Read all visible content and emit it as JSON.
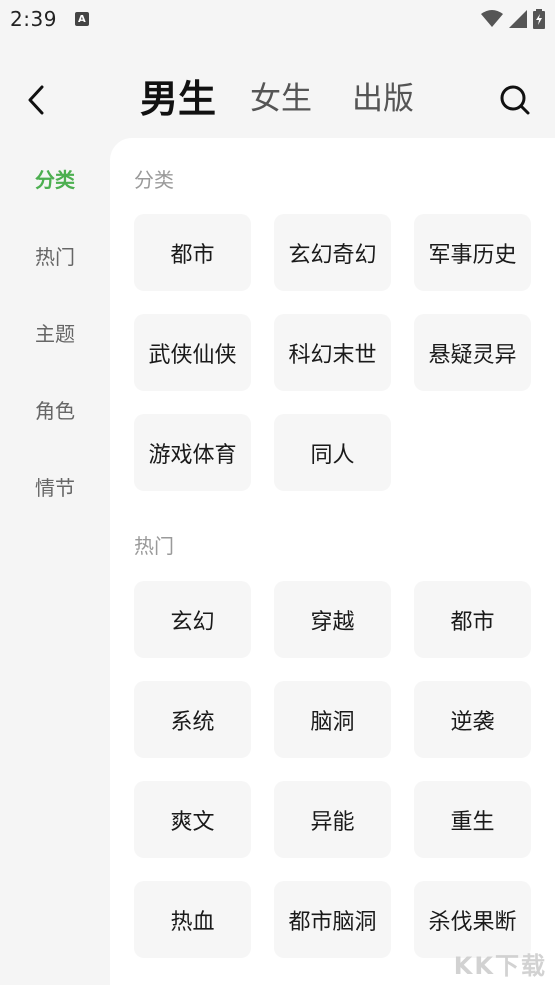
{
  "status_bar": {
    "time": "2:39",
    "app_icon_letter": "A"
  },
  "header": {
    "tabs": [
      {
        "label": "男生",
        "active": true
      },
      {
        "label": "女生",
        "active": false
      },
      {
        "label": "出版",
        "active": false
      }
    ]
  },
  "side_nav": {
    "items": [
      {
        "label": "分类",
        "active": true
      },
      {
        "label": "热门",
        "active": false
      },
      {
        "label": "主题",
        "active": false
      },
      {
        "label": "角色",
        "active": false
      },
      {
        "label": "情节",
        "active": false
      }
    ]
  },
  "sections": [
    {
      "title": "分类",
      "tags": [
        "都市",
        "玄幻奇幻",
        "军事历史",
        "武侠仙侠",
        "科幻末世",
        "悬疑灵异",
        "游戏体育",
        "同人"
      ]
    },
    {
      "title": "热门",
      "tags": [
        "玄幻",
        "穿越",
        "都市",
        "系统",
        "脑洞",
        "逆袭",
        "爽文",
        "异能",
        "重生",
        "热血",
        "都市脑洞",
        "杀伐果断"
      ]
    }
  ],
  "watermark": "KK下载",
  "colors": {
    "accent": "#4caf50",
    "background": "#f5f5f5",
    "panel": "#ffffff",
    "chip": "#f6f6f6"
  }
}
